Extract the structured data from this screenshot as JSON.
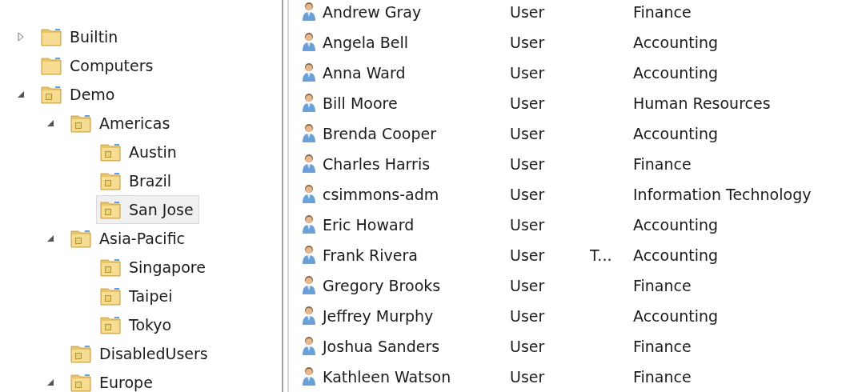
{
  "tree": [
    {
      "label": "Builtin",
      "kind": "container",
      "expanded": false,
      "selected": false
    },
    {
      "label": "Computers",
      "kind": "container",
      "selected": false
    },
    {
      "label": "Demo",
      "kind": "ou",
      "expanded": true,
      "selected": false,
      "children": [
        {
          "label": "Americas",
          "kind": "ou",
          "expanded": true,
          "selected": false,
          "children": [
            {
              "label": "Austin",
              "kind": "ou",
              "selected": false
            },
            {
              "label": "Brazil",
              "kind": "ou",
              "selected": false
            },
            {
              "label": "San Jose",
              "kind": "ou",
              "selected": true
            }
          ]
        },
        {
          "label": "Asia-Pacific",
          "kind": "ou",
          "expanded": true,
          "selected": false,
          "children": [
            {
              "label": "Singapore",
              "kind": "ou",
              "selected": false
            },
            {
              "label": "Taipei",
              "kind": "ou",
              "selected": false
            },
            {
              "label": "Tokyo",
              "kind": "ou",
              "selected": false
            }
          ]
        },
        {
          "label": "DisabledUsers",
          "kind": "ou",
          "selected": false
        },
        {
          "label": "Europe",
          "kind": "ou",
          "expanded": true,
          "selected": false
        }
      ]
    }
  ],
  "table": {
    "rows": [
      {
        "name": "Andrew Gray",
        "type": "User",
        "department": "Finance"
      },
      {
        "name": "Angela Bell",
        "type": "User",
        "department": "Accounting"
      },
      {
        "name": "Anna Ward",
        "type": "User",
        "department": "Accounting"
      },
      {
        "name": "Bill Moore",
        "type": "User",
        "department": "Human Resources"
      },
      {
        "name": "Brenda Cooper",
        "type": "User",
        "department": "Accounting"
      },
      {
        "name": "Charles Harris",
        "type": "User",
        "department": "Finance"
      },
      {
        "name": "csimmons-adm",
        "type": "User",
        "department": "Information Technology"
      },
      {
        "name": "Eric Howard",
        "type": "User",
        "department": "Accounting"
      },
      {
        "name": "Frank Rivera",
        "type": "User",
        "description": "T...",
        "department": "Accounting"
      },
      {
        "name": "Gregory Brooks",
        "type": "User",
        "department": "Finance"
      },
      {
        "name": "Jeffrey Murphy",
        "type": "User",
        "department": "Accounting"
      },
      {
        "name": "Joshua Sanders",
        "type": "User",
        "department": "Finance"
      },
      {
        "name": "Kathleen Watson",
        "type": "User",
        "department": "Finance"
      }
    ]
  }
}
